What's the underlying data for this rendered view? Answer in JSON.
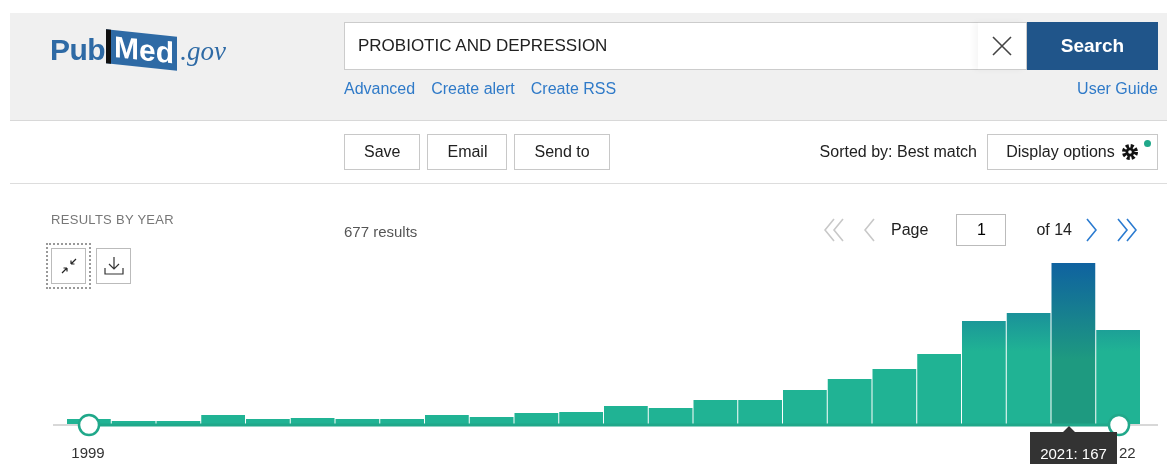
{
  "logo": {
    "parts": [
      "Pub",
      "Med",
      ".gov"
    ]
  },
  "search": {
    "value": "PROBIOTIC AND DEPRESSION",
    "button": "Search"
  },
  "search_links": [
    "Advanced",
    "Create alert",
    "Create RSS"
  ],
  "user_guide": "User Guide",
  "actions": [
    "Save",
    "Email",
    "Send to"
  ],
  "sort": "Sorted by: Best match",
  "display_options": {
    "label": "Display options",
    "notification": true
  },
  "timeline": {
    "title": "RESULTS BY YEAR",
    "start_label": "1999",
    "end_label": "22",
    "tooltip": "2021: 167",
    "handles": [
      {
        "level": 0
      },
      {
        "level": 1
      }
    ]
  },
  "results_count": "677 results",
  "pagination": {
    "page_label": "Page",
    "page": "1",
    "of": "of 14",
    "first_disabled": true,
    "prev_disabled": true,
    "next_disabled": false,
    "last_disabled": false
  }
}
